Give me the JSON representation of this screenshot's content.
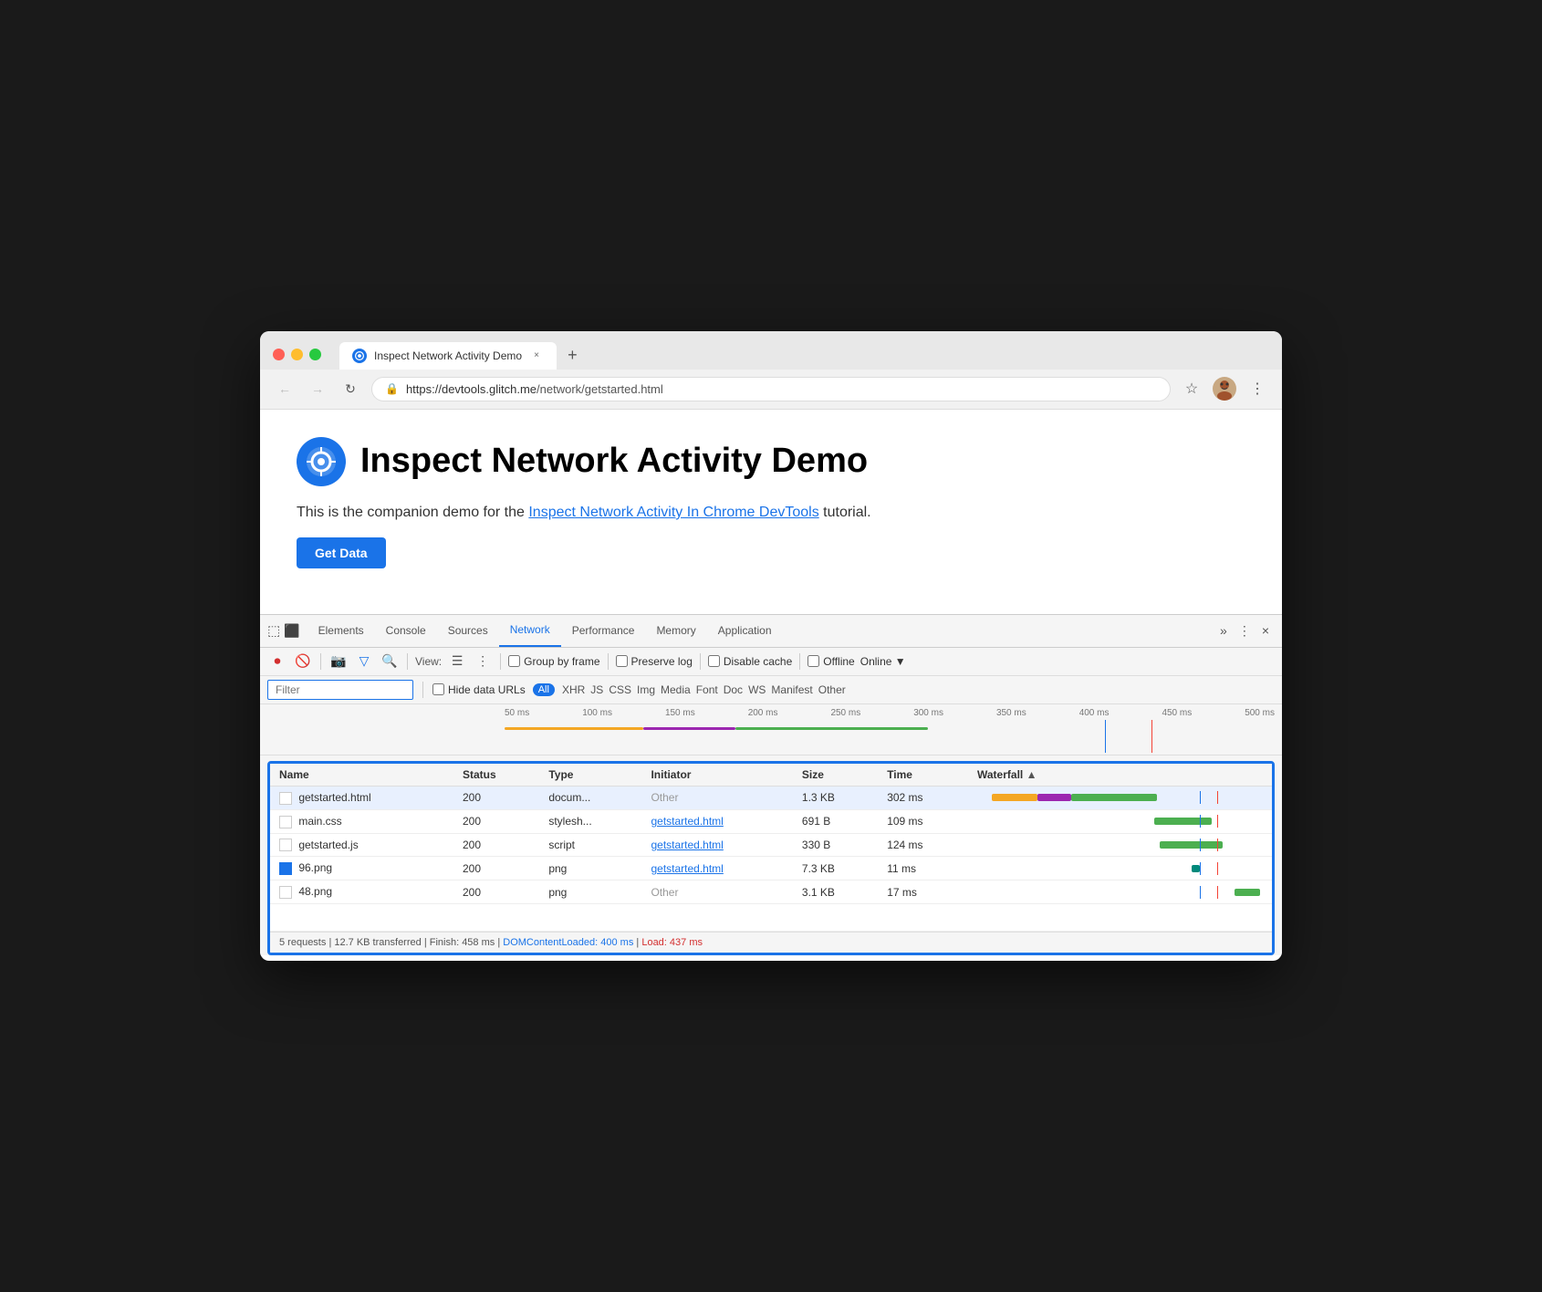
{
  "browser": {
    "tab_title": "Inspect Network Activity Demo",
    "tab_close": "×",
    "new_tab": "+",
    "url_lock": "🔒",
    "url_base": "https://devtools.glitch.me",
    "url_path": "/network/getstarted.html",
    "url_full": "https://devtools.glitch.me/network/getstarted.html"
  },
  "page": {
    "title": "Inspect Network Activity Demo",
    "description_before": "This is the companion demo for the ",
    "link_text": "Inspect Network Activity In Chrome DevTools",
    "description_after": " tutorial.",
    "get_data_label": "Get Data"
  },
  "devtools": {
    "tabs": [
      "Elements",
      "Console",
      "Sources",
      "Network",
      "Performance",
      "Memory",
      "Application"
    ],
    "active_tab": "Network",
    "more_label": "»",
    "settings_label": "⋮",
    "close_label": "×"
  },
  "network_toolbar": {
    "view_label": "View:",
    "group_by_frame": "Group by frame",
    "preserve_log": "Preserve log",
    "disable_cache": "Disable cache",
    "offline_label": "Offline",
    "online_label": "Online"
  },
  "filter_bar": {
    "placeholder": "Filter",
    "hide_data_urls": "Hide data URLs",
    "all_badge": "All",
    "types": [
      "XHR",
      "JS",
      "CSS",
      "Img",
      "Media",
      "Font",
      "Doc",
      "WS",
      "Manifest",
      "Other"
    ]
  },
  "timeline": {
    "scale": [
      "50 ms",
      "100 ms",
      "150 ms",
      "200 ms",
      "250 ms",
      "300 ms",
      "350 ms",
      "400 ms",
      "450 ms",
      "500 ms"
    ]
  },
  "table": {
    "headers": [
      "Name",
      "Status",
      "Type",
      "Initiator",
      "Size",
      "Time",
      "Waterfall"
    ],
    "rows": [
      {
        "name": "getstarted.html",
        "status": "200",
        "type": "docum...",
        "initiator": "Other",
        "initiator_link": false,
        "size": "1.3 KB",
        "time": "302 ms",
        "icon": "file",
        "selected": true
      },
      {
        "name": "main.css",
        "status": "200",
        "type": "stylesh...",
        "initiator": "getstarted.html",
        "initiator_link": true,
        "size": "691 B",
        "time": "109 ms",
        "icon": "file",
        "selected": false
      },
      {
        "name": "getstarted.js",
        "status": "200",
        "type": "script",
        "initiator": "getstarted.html",
        "initiator_link": true,
        "size": "330 B",
        "time": "124 ms",
        "icon": "file",
        "selected": false
      },
      {
        "name": "96.png",
        "status": "200",
        "type": "png",
        "initiator": "getstarted.html",
        "initiator_link": true,
        "size": "7.3 KB",
        "time": "11 ms",
        "icon": "image",
        "selected": false
      },
      {
        "name": "48.png",
        "status": "200",
        "type": "png",
        "initiator": "Other",
        "initiator_link": false,
        "size": "3.1 KB",
        "time": "17 ms",
        "icon": "file",
        "selected": false
      }
    ]
  },
  "status_bar": {
    "requests": "5 requests",
    "transferred": "12.7 KB transferred",
    "finish": "Finish: 458 ms",
    "dom_content_label": "DOMContentLoaded:",
    "dom_content_value": "400 ms",
    "load_label": "Load:",
    "load_value": "437 ms",
    "separator": "|"
  }
}
